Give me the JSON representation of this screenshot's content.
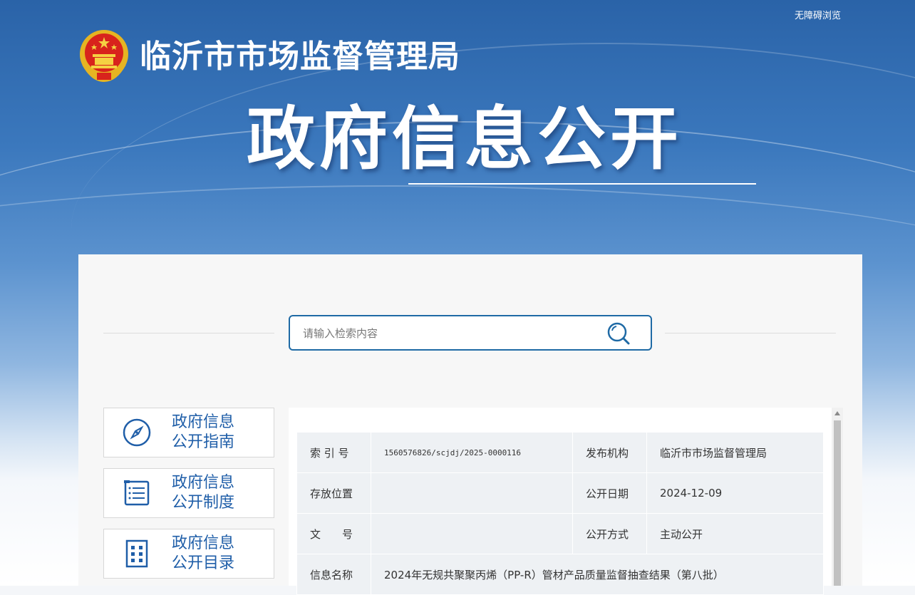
{
  "header": {
    "accessibility_label": "无障碍浏览",
    "site_title": "临沂市市场监督管理局",
    "hero_title": "政府信息公开"
  },
  "search": {
    "placeholder": "请输入检索内容"
  },
  "sidebar": {
    "items": [
      {
        "line1": "政府信息",
        "line2": "公开指南",
        "icon": "compass-icon"
      },
      {
        "line1": "政府信息",
        "line2": "公开制度",
        "icon": "document-list-icon"
      },
      {
        "line1": "政府信息",
        "line2": "公开目录",
        "icon": "catalog-grid-icon"
      }
    ]
  },
  "meta": {
    "index_label": "索 引 号",
    "index_value": "1560576826/scjdj/2025-0000116",
    "publisher_label": "发布机构",
    "publisher_value": "临沂市市场监督管理局",
    "location_label": "存放位置",
    "location_value": "",
    "date_label": "公开日期",
    "date_value": "2024-12-09",
    "docno_label": "文　　号",
    "docno_value": "",
    "mode_label": "公开方式",
    "mode_value": "主动公开",
    "name_label": "信息名称",
    "name_value": "2024年无规共聚聚丙烯（PP-R）管材产品质量监督抽查结果（第八批）"
  },
  "colors": {
    "accent": "#1f5ea8",
    "search_border": "#1f6aa5"
  }
}
